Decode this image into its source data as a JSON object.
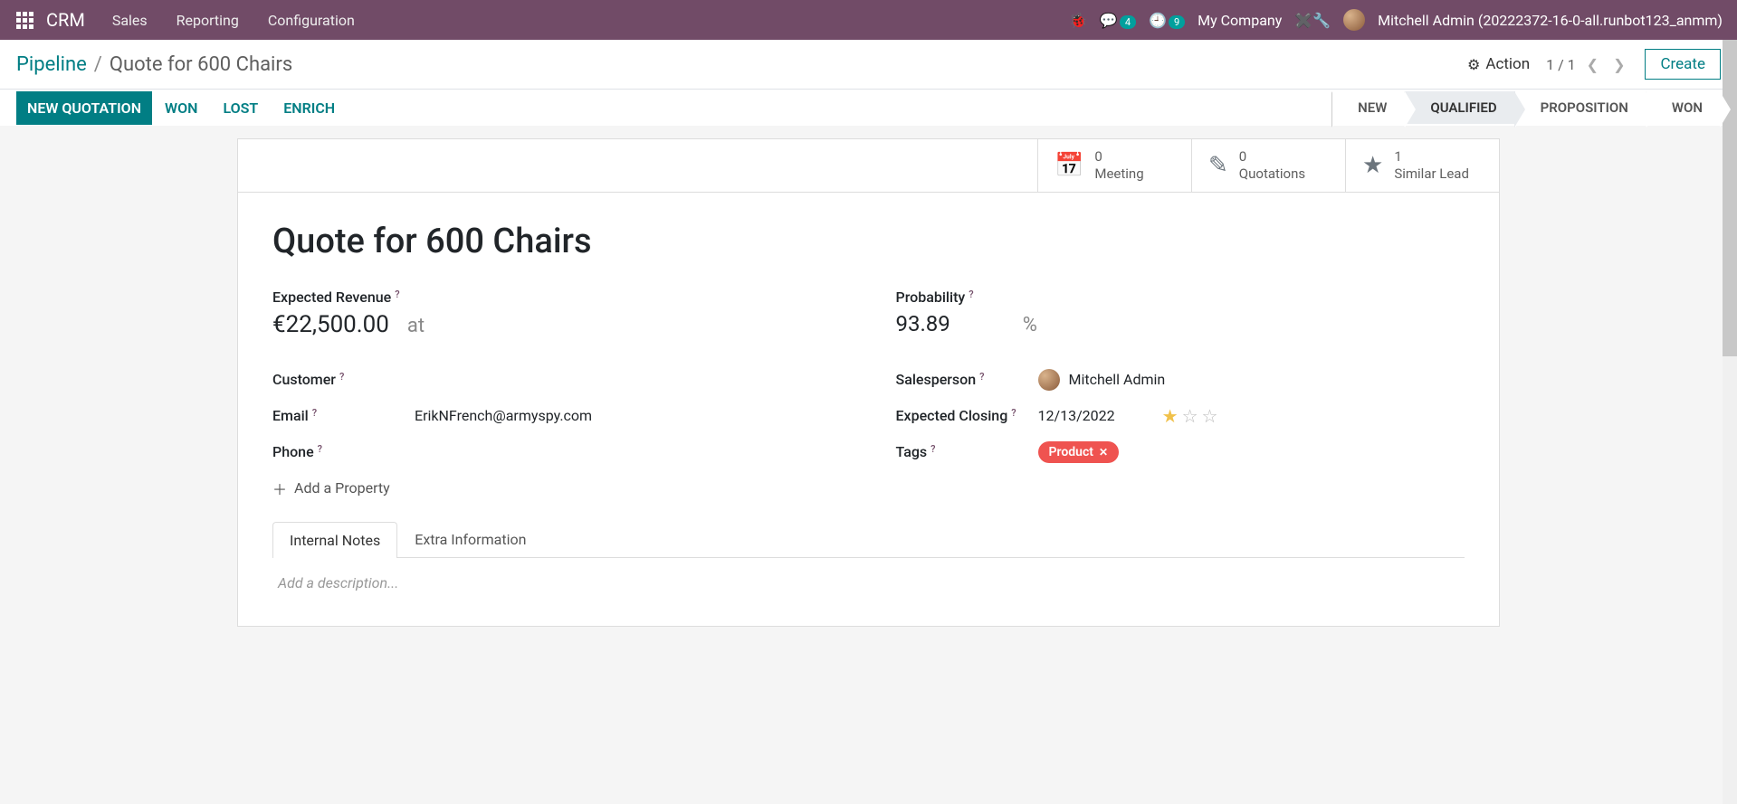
{
  "navbar": {
    "brand": "CRM",
    "menu": [
      "Sales",
      "Reporting",
      "Configuration"
    ],
    "messages_badge": "4",
    "activities_badge": "9",
    "company": "My Company",
    "user": "Mitchell Admin (20222372-16-0-all.runbot123_anmm)"
  },
  "breadcrumb": {
    "parent": "Pipeline",
    "current": "Quote for 600 Chairs"
  },
  "cp": {
    "action_label": "Action",
    "pager": "1 / 1",
    "create_label": "Create"
  },
  "header_buttons": {
    "primary": "NEW QUOTATION",
    "won": "WON",
    "lost": "LOST",
    "enrich": "ENRICH"
  },
  "stages": [
    "NEW",
    "QUALIFIED",
    "PROPOSITION",
    "WON"
  ],
  "active_stage": "QUALIFIED",
  "stat_buttons": {
    "meeting": {
      "count": "0",
      "label": "Meeting"
    },
    "quotations": {
      "count": "0",
      "label": "Quotations"
    },
    "similar": {
      "count": "1",
      "label": "Similar Lead"
    }
  },
  "record": {
    "title": "Quote for 600 Chairs",
    "expected_revenue_label": "Expected Revenue",
    "expected_revenue": "€22,500.00",
    "at_word": "at",
    "probability_label": "Probability",
    "probability": "93.89",
    "pct": "%",
    "customer_label": "Customer",
    "customer": "",
    "email_label": "Email",
    "email": "ErikNFrench@armyspy.com",
    "phone_label": "Phone",
    "phone": "",
    "salesperson_label": "Salesperson",
    "salesperson": "Mitchell Admin",
    "expected_closing_label": "Expected Closing",
    "expected_closing": "12/13/2022",
    "tags_label": "Tags",
    "tag": "Product",
    "priority_stars": 1,
    "add_property": "Add a Property"
  },
  "tabs": {
    "internal_notes": "Internal Notes",
    "extra_info": "Extra Information",
    "description_placeholder": "Add a description..."
  }
}
